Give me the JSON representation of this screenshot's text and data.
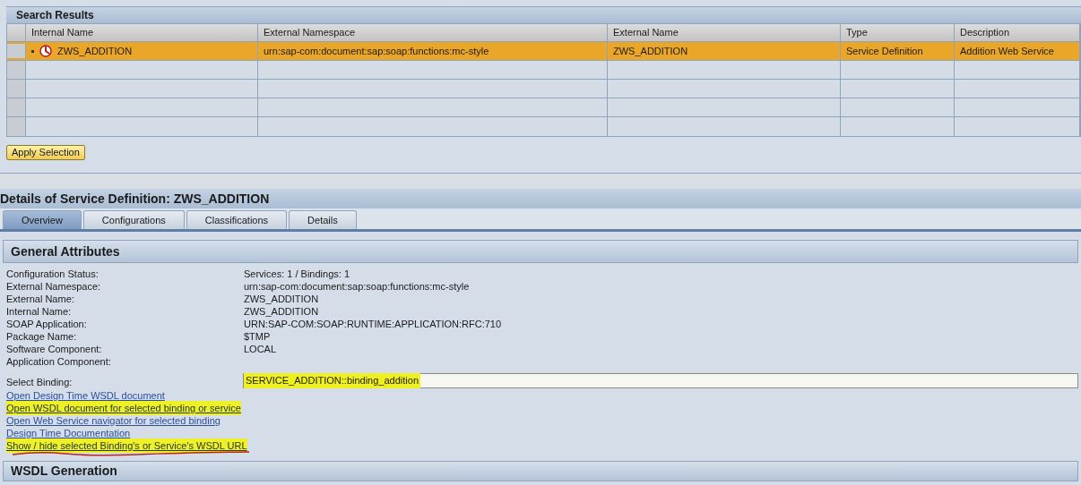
{
  "search_results": {
    "title": "Search Results",
    "columns": [
      "Internal Name",
      "External Namespace",
      "External Name",
      "Type",
      "Description"
    ],
    "rows": [
      {
        "selected": true,
        "cells": [
          "ZWS_ADDITION",
          "urn:sap-com:document:sap:soap:functions:mc-style",
          "ZWS_ADDITION",
          "Service Definition",
          "Addition Web Service"
        ]
      }
    ],
    "apply_button": "Apply Selection"
  },
  "details": {
    "title": "Details of Service Definition: ZWS_ADDITION",
    "tabs": [
      {
        "label": "Overview",
        "selected": true
      },
      {
        "label": "Configurations",
        "selected": false
      },
      {
        "label": "Classifications",
        "selected": false
      },
      {
        "label": "Details",
        "selected": false
      }
    ]
  },
  "general_attributes": {
    "title": "General Attributes",
    "attributes": [
      {
        "label": "Configuration Status:",
        "value": "Services: 1 / Bindings: 1"
      },
      {
        "label": "External Namespace:",
        "value": "urn:sap-com:document:sap:soap:functions:mc-style"
      },
      {
        "label": "External Name:",
        "value": "ZWS_ADDITION"
      },
      {
        "label": "Internal Name:",
        "value": "ZWS_ADDITION"
      },
      {
        "label": "SOAP Application:",
        "value": "URN:SAP-COM:SOAP:RUNTIME:APPLICATION:RFC:710"
      },
      {
        "label": "Package Name:",
        "value": "$TMP"
      },
      {
        "label": "Software Component:",
        "value": "LOCAL"
      },
      {
        "label": "Application Component:"
      }
    ],
    "select_binding": {
      "label": "Select Binding:",
      "value": "SERVICE_ADDITION::binding_addition",
      "highlighted": true
    },
    "links": [
      {
        "text": "Open Design Time WSDL document",
        "highlighted": false,
        "red_underline": false
      },
      {
        "text": "Open WSDL document for selected binding or service",
        "highlighted": true,
        "red_underline": false
      },
      {
        "text": "Open Web Service navigator for selected binding",
        "highlighted": false,
        "red_underline": false
      },
      {
        "text": "Design Time Documentation",
        "highlighted": false,
        "red_underline": false
      },
      {
        "text": "Show / hide selected Binding's or Service's WSDL URL",
        "highlighted": true,
        "red_underline": true
      }
    ]
  },
  "wsdl_generation": {
    "title": "WSDL Generation"
  }
}
